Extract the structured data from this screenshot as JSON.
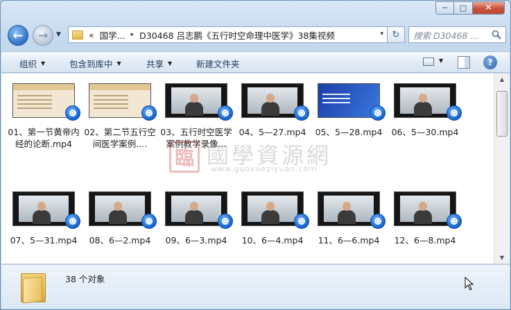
{
  "window": {
    "minimize_glyph": "─",
    "maximize_glyph": "□",
    "close_glyph": "✕"
  },
  "address_bar": {
    "chevron": "«",
    "crumbs": [
      "国学...",
      "D30468 吕志鹏《五行时空命理中医学》38集视频"
    ],
    "separator": "▸",
    "dropdown_glyph": "▾"
  },
  "search": {
    "placeholder": "搜索 D30468 ..."
  },
  "toolbar": {
    "organize": "组织",
    "include_in_library": "包含到库中",
    "share": "共享",
    "new_folder": "新建文件夹",
    "help_glyph": "?"
  },
  "files": [
    {
      "name": "01、第一节黄帝内经的论断.mp4",
      "thumb": "slide"
    },
    {
      "name": "02、第二节五行空间医学案例....",
      "thumb": "slide"
    },
    {
      "name": "03、五行时空医学案例教学录像...",
      "thumb": "video"
    },
    {
      "name": "04、5—27.mp4",
      "thumb": "video"
    },
    {
      "name": "05、5—28.mp4",
      "thumb": "blue"
    },
    {
      "name": "06、5—30.mp4",
      "thumb": "video"
    },
    {
      "name": "07、5—31.mp4",
      "thumb": "video"
    },
    {
      "name": "08、6—2.mp4",
      "thumb": "video"
    },
    {
      "name": "09、6—3.mp4",
      "thumb": "video"
    },
    {
      "name": "10、6—4.mp4",
      "thumb": "video"
    },
    {
      "name": "11、6—6.mp4",
      "thumb": "video"
    },
    {
      "name": "12、6—8.mp4",
      "thumb": "video"
    }
  ],
  "watermark": {
    "seal": "臨",
    "title": "國學資源網",
    "url": "www.guoxueziyuan.com"
  },
  "status": {
    "count_text": "38 个对象"
  },
  "icons": {
    "back": "back-arrow-icon",
    "forward": "forward-arrow-icon",
    "folder": "folder-icon",
    "refresh": "refresh-icon",
    "search": "search-icon",
    "media": "media-player-badge-icon"
  }
}
